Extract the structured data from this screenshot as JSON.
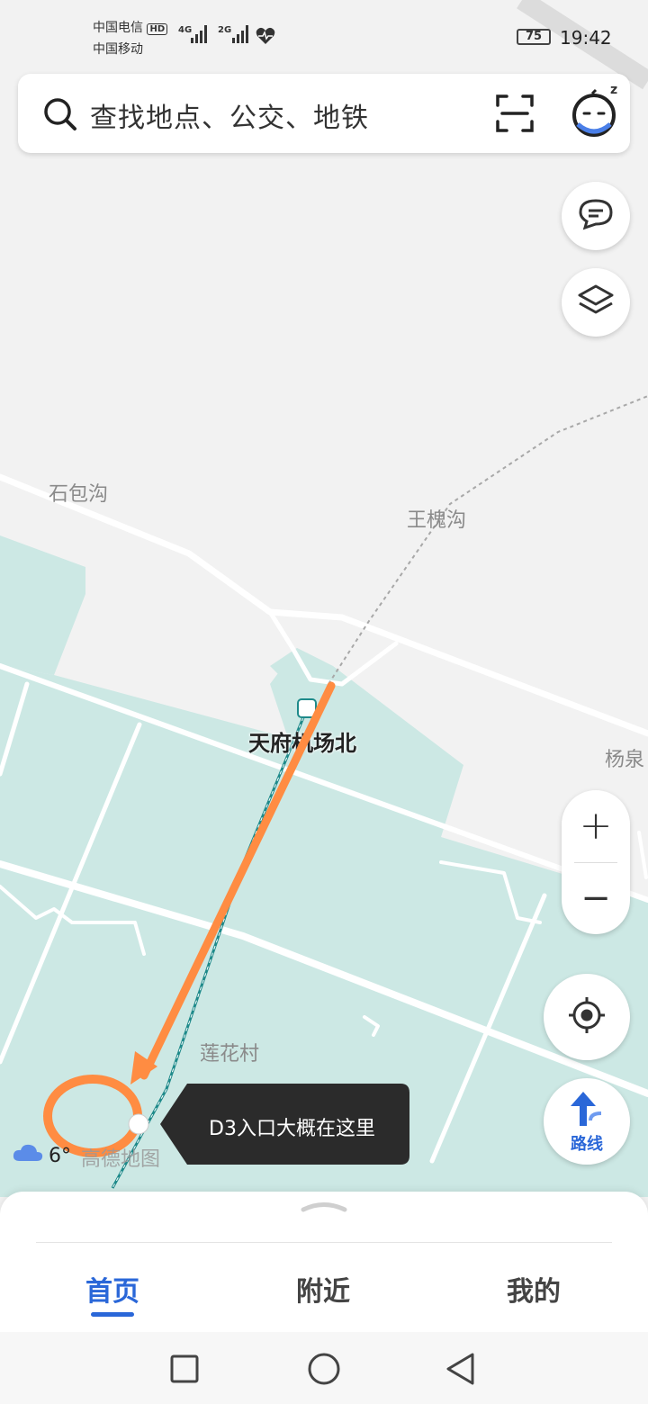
{
  "status_bar": {
    "carrier_1": "中国电信",
    "carrier_1_badge": "HD",
    "carrier_2": "中国移动",
    "network_1": "4G",
    "network_2": "2G",
    "battery": "75",
    "time": "19:42"
  },
  "search": {
    "placeholder": "查找地点、公交、地铁",
    "scan_icon": "scan-icon",
    "assistant_icon": "sleeping-assistant-icon",
    "assistant_badge": "z"
  },
  "map": {
    "labels": {
      "shibaogou": "石包沟",
      "wanghuaigou": "王槐沟",
      "yangquan": "杨泉",
      "lianhuacun": "莲花村",
      "station": "天府机场北"
    },
    "annotation_text": "D3入口大概在这里",
    "weather_temp": "6°",
    "watermark": "高德地图",
    "colors": {
      "land": "#f2f2f2",
      "zone": "#cce8e4",
      "road": "#ffffff",
      "annotation_orange": "#ff8c42",
      "rail": "#1e8a8a"
    }
  },
  "controls": {
    "message_icon": "message-icon",
    "layers_icon": "layers-icon",
    "zoom_in": "+",
    "zoom_out": "−",
    "locate_icon": "locate-icon",
    "route_label": "路线"
  },
  "bottom_tabs": [
    {
      "label": "首页",
      "active": true
    },
    {
      "label": "附近",
      "active": false
    },
    {
      "label": "我的",
      "active": false
    }
  ],
  "nav": {
    "recent_icon": "square-icon",
    "home_icon": "circle-icon",
    "back_icon": "triangle-back-icon"
  }
}
